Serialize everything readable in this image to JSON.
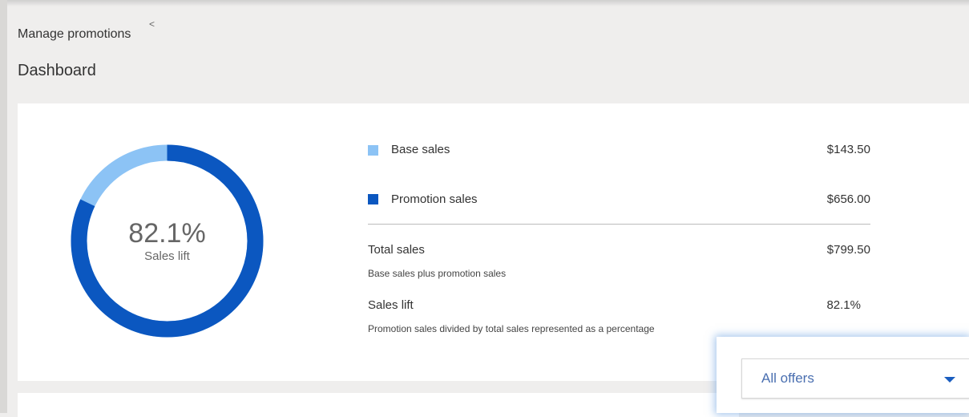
{
  "header": {
    "breadcrumb": "Manage promotions",
    "breadcrumb_chevron": "<",
    "title": "Dashboard"
  },
  "donut": {
    "value_label": "82.1%",
    "caption": "Sales lift",
    "promotion_fraction": 0.821,
    "colors": {
      "base": "#8cc3f5",
      "promotion": "#0b57c0"
    }
  },
  "legend": [
    {
      "label": "Base sales",
      "value": "$143.50",
      "color": "#8cc3f5"
    },
    {
      "label": "Promotion sales",
      "value": "$656.00",
      "color": "#0b57c0"
    }
  ],
  "summary": {
    "total_label": "Total sales",
    "total_value": "$799.50",
    "total_desc": "Base sales plus promotion sales",
    "lift_label": "Sales lift",
    "lift_value": "82.1%",
    "lift_desc": "Promotion sales divided by total sales represented as a percentage"
  },
  "filter": {
    "selected": "All offers",
    "icon": "chevron-down-icon",
    "accent": "#1a5dbf"
  }
}
